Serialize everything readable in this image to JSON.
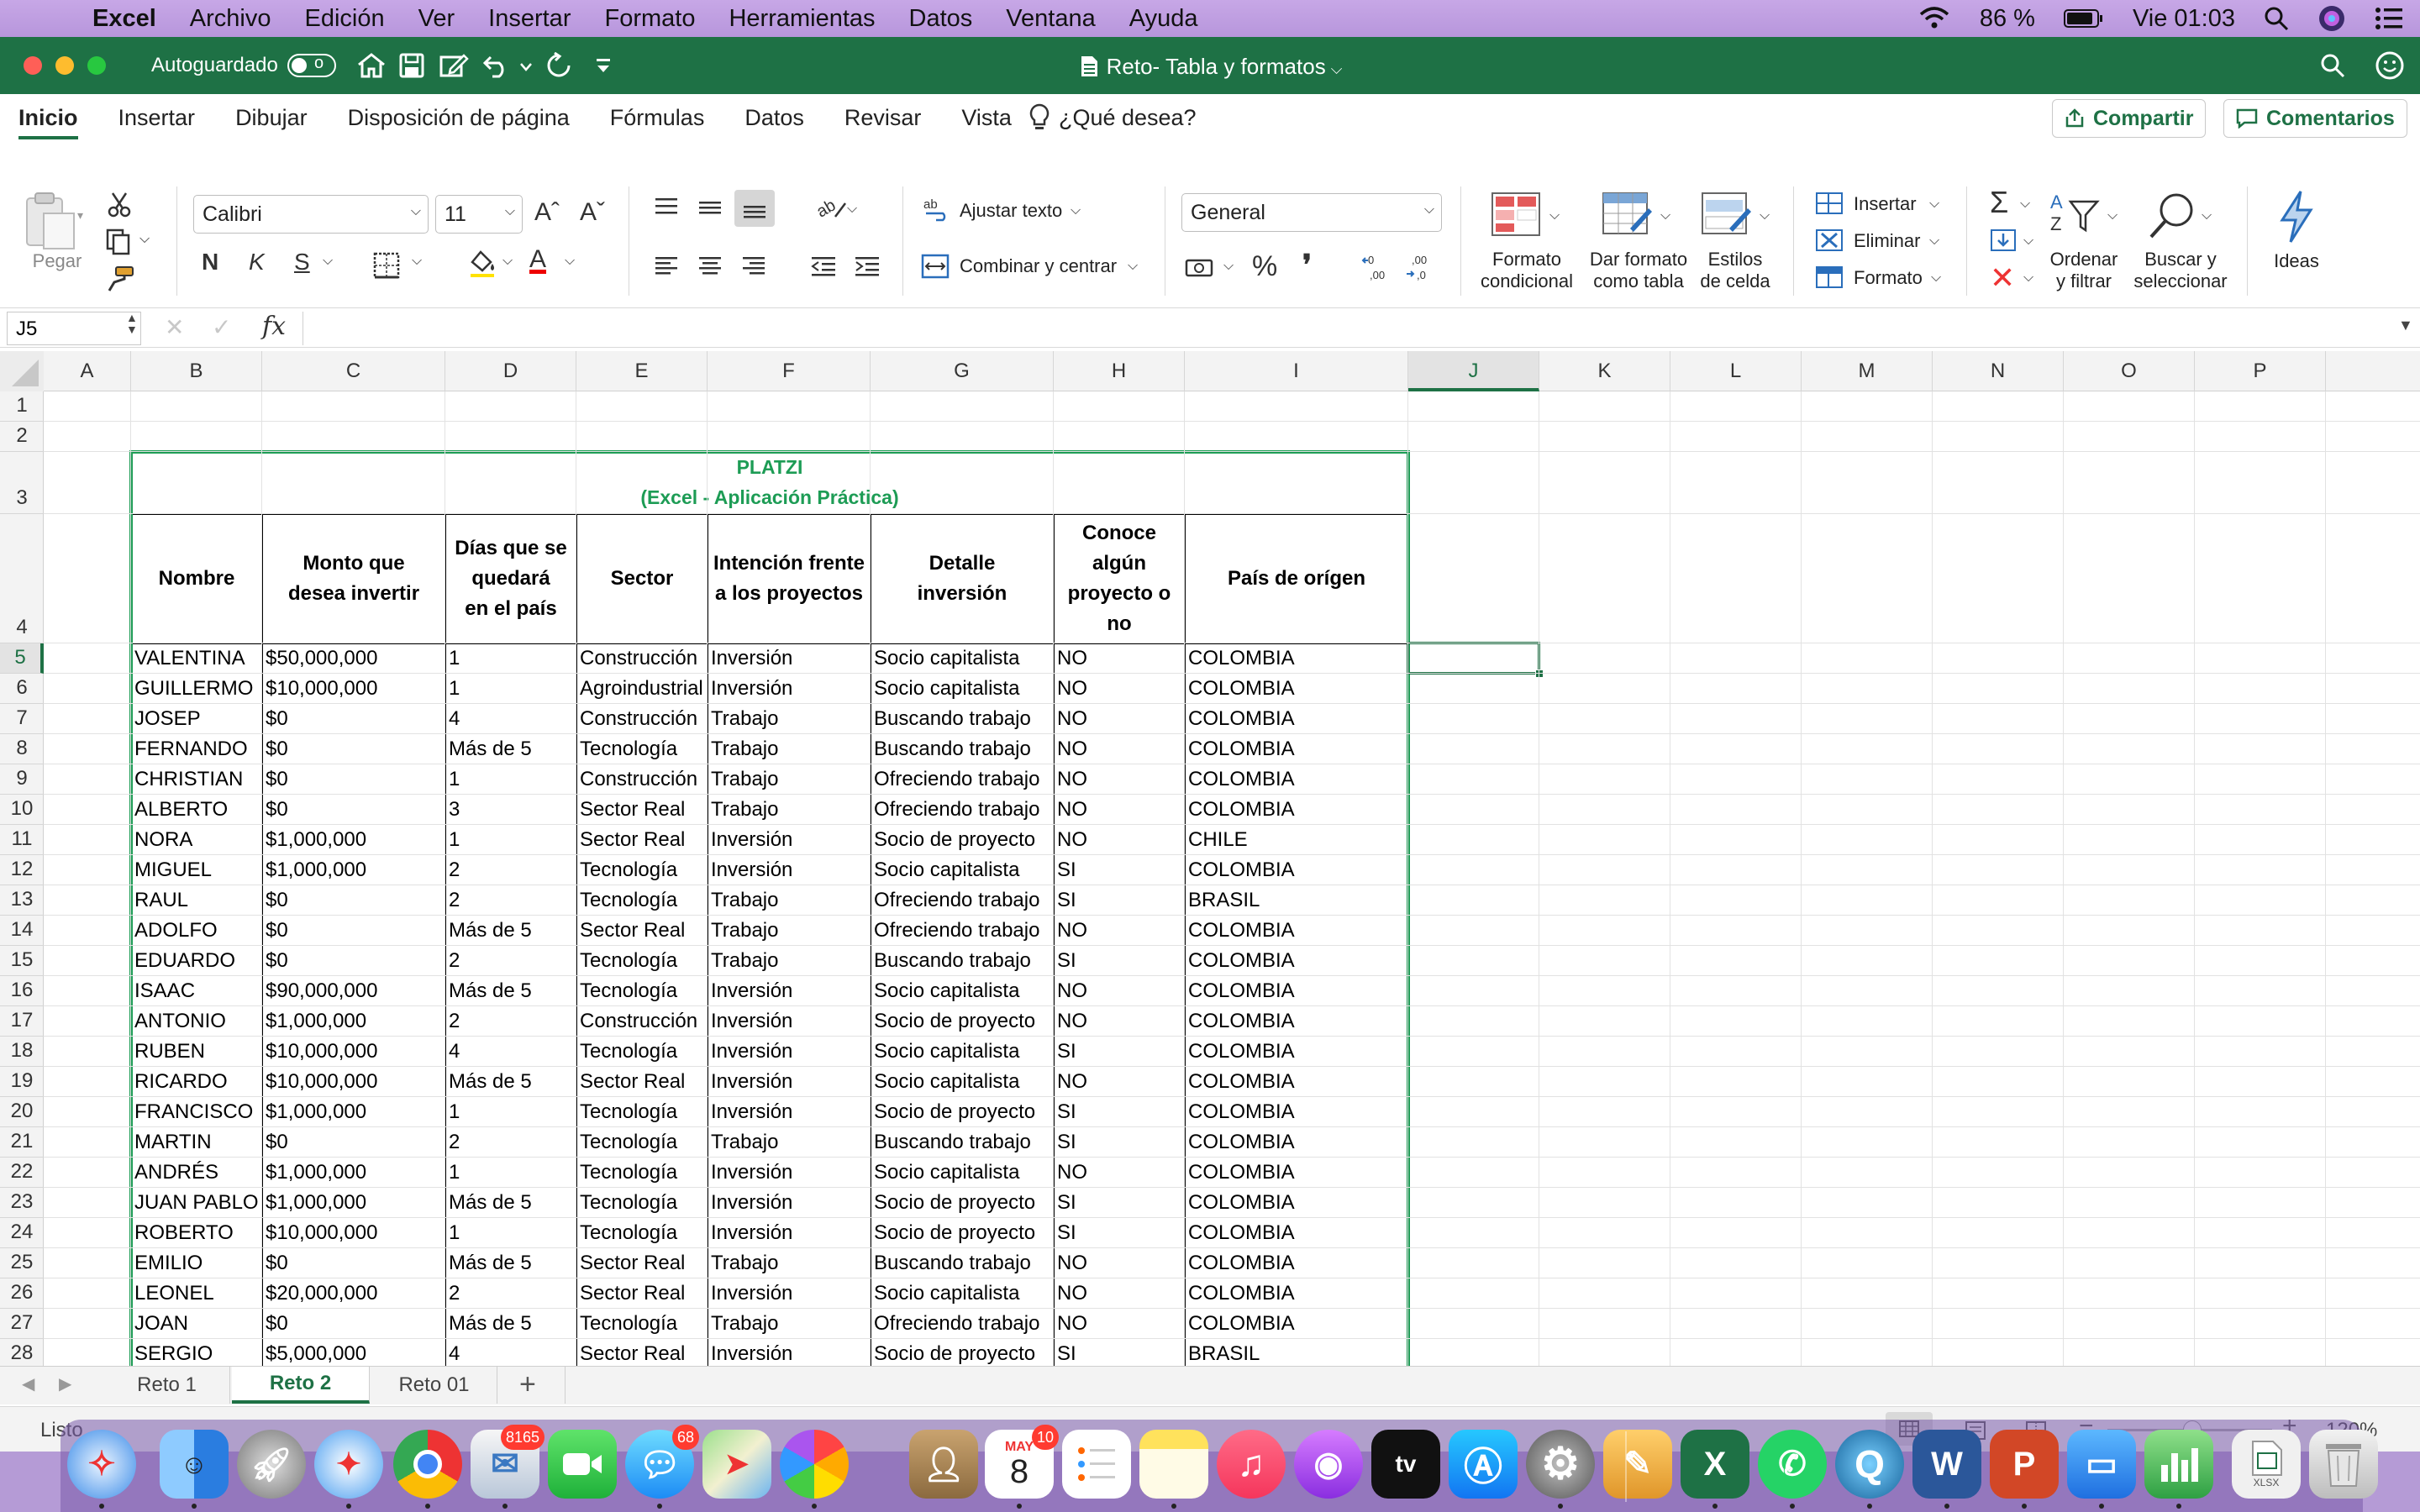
{
  "menubar": {
    "app": "Excel",
    "items": [
      "Archivo",
      "Edición",
      "Ver",
      "Insertar",
      "Formato",
      "Herramientas",
      "Datos",
      "Ventana",
      "Ayuda"
    ],
    "battery": "86 %",
    "clock": "Vie 01:03"
  },
  "titlebar": {
    "autosave_label": "Autoguardado",
    "autosave_state": "o",
    "doc_title": "Reto- Tabla y formatos"
  },
  "tabs": [
    "Inicio",
    "Insertar",
    "Dibujar",
    "Disposición de página",
    "Fórmulas",
    "Datos",
    "Revisar",
    "Vista"
  ],
  "tell_me": "¿Qué desea?",
  "share_label": "Compartir",
  "comments_label": "Comentarios",
  "ribbon": {
    "paste_label": "Pegar",
    "font_name": "Calibri",
    "font_size": "11",
    "bold": "N",
    "italic": "K",
    "underline": "S",
    "wrap_text": "Ajustar texto",
    "merge_center": "Combinar y centrar",
    "number_format": "General",
    "cond_format": [
      "Formato",
      "condicional"
    ],
    "format_table": [
      "Dar formato",
      "como tabla"
    ],
    "cell_styles": [
      "Estilos",
      "de celda"
    ],
    "insert": "Insertar",
    "delete": "Eliminar",
    "format": "Formato",
    "sort_filter": [
      "Ordenar",
      "y filtrar"
    ],
    "find_select": [
      "Buscar y",
      "seleccionar"
    ],
    "ideas": "Ideas",
    "percent": "%",
    "comma": "❜"
  },
  "formula_bar": {
    "name_box": "J5",
    "fx": "fx",
    "content": ""
  },
  "columns": [
    "A",
    "B",
    "C",
    "D",
    "E",
    "F",
    "G",
    "H",
    "I",
    "J",
    "K",
    "L",
    "M",
    "N",
    "O",
    "P"
  ],
  "selected_column": "J",
  "selected_row": 5,
  "table": {
    "title_line1": "PLATZI",
    "title_line2": "(Excel - Aplicación Práctica)",
    "headers": [
      [
        "Nombre"
      ],
      [
        "Monto que",
        "desea invertir"
      ],
      [
        "Días que se",
        "quedará",
        "en el país"
      ],
      [
        "Sector"
      ],
      [
        "Intención frente",
        "a los proyectos"
      ],
      [
        "Detalle",
        "inversión"
      ],
      [
        "Conoce algún",
        "proyecto o",
        "no"
      ],
      [
        "País de orígen"
      ]
    ],
    "rows": [
      [
        "VALENTINA",
        "$50,000,000",
        "1",
        "Construcción",
        "Inversión",
        "Socio capitalista",
        "NO",
        "COLOMBIA"
      ],
      [
        "GUILLERMO",
        "$10,000,000",
        "1",
        "Agroindustrial",
        "Inversión",
        "Socio capitalista",
        "NO",
        "COLOMBIA"
      ],
      [
        "JOSEP",
        "$0",
        "4",
        "Construcción",
        "Trabajo",
        "Buscando trabajo",
        "NO",
        "COLOMBIA"
      ],
      [
        "FERNANDO",
        "$0",
        "Más de 5",
        "Tecnología",
        "Trabajo",
        "Buscando trabajo",
        "NO",
        "COLOMBIA"
      ],
      [
        "CHRISTIAN",
        "$0",
        "1",
        "Construcción",
        "Trabajo",
        "Ofreciendo trabajo",
        "NO",
        "COLOMBIA"
      ],
      [
        "ALBERTO",
        "$0",
        "3",
        "Sector Real",
        "Trabajo",
        "Ofreciendo trabajo",
        "NO",
        "COLOMBIA"
      ],
      [
        "NORA",
        "$1,000,000",
        "1",
        "Sector Real",
        "Inversión",
        "Socio de proyecto",
        "NO",
        "CHILE"
      ],
      [
        "MIGUEL",
        "$1,000,000",
        "2",
        "Tecnología",
        "Inversión",
        "Socio capitalista",
        "SI",
        "COLOMBIA"
      ],
      [
        "RAUL",
        "$0",
        "2",
        "Tecnología",
        "Trabajo",
        "Ofreciendo trabajo",
        "SI",
        "BRASIL"
      ],
      [
        "ADOLFO",
        "$0",
        "Más de 5",
        "Sector Real",
        "Trabajo",
        "Ofreciendo trabajo",
        "NO",
        "COLOMBIA"
      ],
      [
        "EDUARDO",
        "$0",
        "2",
        "Tecnología",
        "Trabajo",
        "Buscando trabajo",
        "SI",
        "COLOMBIA"
      ],
      [
        "ISAAC",
        "$90,000,000",
        "Más de 5",
        "Tecnología",
        "Inversión",
        "Socio capitalista",
        "NO",
        "COLOMBIA"
      ],
      [
        "ANTONIO",
        "$1,000,000",
        "2",
        "Construcción",
        "Inversión",
        "Socio de proyecto",
        "NO",
        "COLOMBIA"
      ],
      [
        "RUBEN",
        "$10,000,000",
        "4",
        "Tecnología",
        "Inversión",
        "Socio capitalista",
        "SI",
        "COLOMBIA"
      ],
      [
        "RICARDO",
        "$10,000,000",
        "Más de 5",
        "Sector Real",
        "Inversión",
        "Socio capitalista",
        "NO",
        "COLOMBIA"
      ],
      [
        "FRANCISCO",
        "$1,000,000",
        "1",
        "Tecnología",
        "Inversión",
        "Socio de proyecto",
        "SI",
        "COLOMBIA"
      ],
      [
        "MARTIN",
        "$0",
        "2",
        "Tecnología",
        "Trabajo",
        "Buscando trabajo",
        "SI",
        "COLOMBIA"
      ],
      [
        "ANDRÉS",
        "$1,000,000",
        "1",
        "Tecnología",
        "Inversión",
        "Socio capitalista",
        "NO",
        "COLOMBIA"
      ],
      [
        "JUAN PABLO",
        "$1,000,000",
        "Más de 5",
        "Tecnología",
        "Inversión",
        "Socio de proyecto",
        "SI",
        "COLOMBIA"
      ],
      [
        "ROBERTO",
        "$10,000,000",
        "1",
        "Tecnología",
        "Inversión",
        "Socio de proyecto",
        "SI",
        "COLOMBIA"
      ],
      [
        "EMILIO",
        "$0",
        "Más de 5",
        "Sector Real",
        "Trabajo",
        "Buscando trabajo",
        "NO",
        "COLOMBIA"
      ],
      [
        "LEONEL",
        "$20,000,000",
        "2",
        "Sector Real",
        "Inversión",
        "Socio capitalista",
        "NO",
        "COLOMBIA"
      ],
      [
        "JOAN",
        "$0",
        "Más de 5",
        "Tecnología",
        "Trabajo",
        "Ofreciendo trabajo",
        "NO",
        "COLOMBIA"
      ],
      [
        "SERGIO",
        "$5,000,000",
        "4",
        "Sector Real",
        "Inversión",
        "Socio de proyecto",
        "SI",
        "BRASIL"
      ]
    ]
  },
  "sheets": [
    "Reto 1",
    "Reto 2",
    "Reto 01"
  ],
  "active_sheet": "Reto 2",
  "status": {
    "text": "Listo",
    "zoom": "120%"
  },
  "dock": {
    "badges": {
      "mail": "8165",
      "messages": "68",
      "calendar_month": "MAY",
      "calendar_day": "8",
      "calendar_badge": "10"
    },
    "file_label": "XLSX",
    "appletv": "tv",
    "excel": "X",
    "word": "W",
    "powerpoint": "P"
  },
  "colors": {
    "excel_green": "#1e7145",
    "table_border": "#1d9c55",
    "menubar": "#c7a7e6"
  }
}
